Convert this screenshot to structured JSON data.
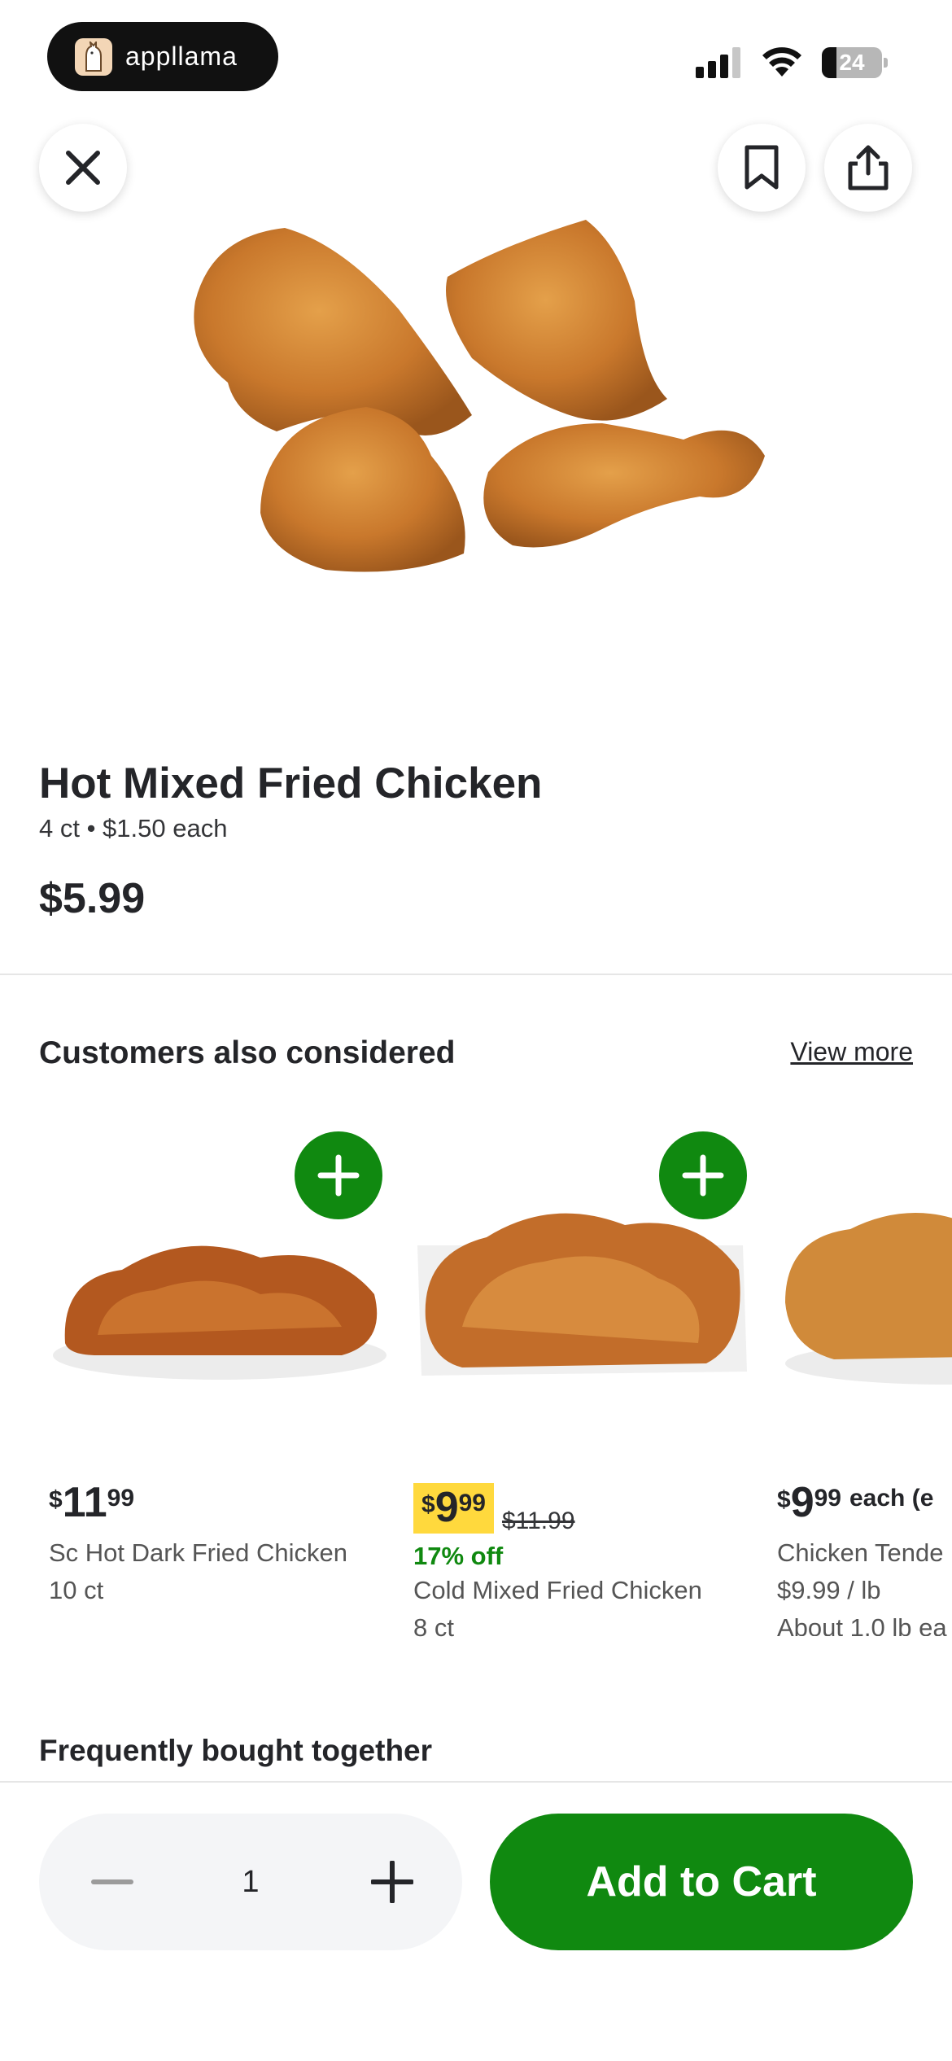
{
  "status_bar": {
    "app_name": "appllama",
    "battery": "24",
    "battery_level": 0.24
  },
  "product": {
    "title": "Hot Mixed Fried Chicken",
    "subtitle": "4 ct • $1.50 each",
    "price": "$5.99",
    "image": "fried-chicken-image"
  },
  "considered": {
    "title": "Customers also considered",
    "view_more": "View more",
    "items": [
      {
        "currency": "$",
        "price_main": "11",
        "price_cents": "99",
        "name": "Sc Hot Dark Fried Chicken",
        "detail": "10 ct"
      },
      {
        "currency": "$",
        "price_main": "9",
        "price_cents": "99",
        "original_price": "$11.99",
        "discount": "17% off",
        "name": "Cold Mixed Fried Chicken",
        "detail": "8 ct"
      },
      {
        "currency": "$",
        "price_main": "9",
        "price_cents": "99",
        "each": "each (e",
        "name": "Chicken Tende",
        "detail": "$9.99 / lb",
        "detail2": "About 1.0 lb ea"
      }
    ]
  },
  "frequently_bought": {
    "title": "Frequently bought together"
  },
  "cart": {
    "quantity": "1",
    "add_label": "Add to Cart"
  },
  "colors": {
    "accent": "#108910",
    "sale_highlight": "#ffd93d",
    "text": "#242529"
  }
}
